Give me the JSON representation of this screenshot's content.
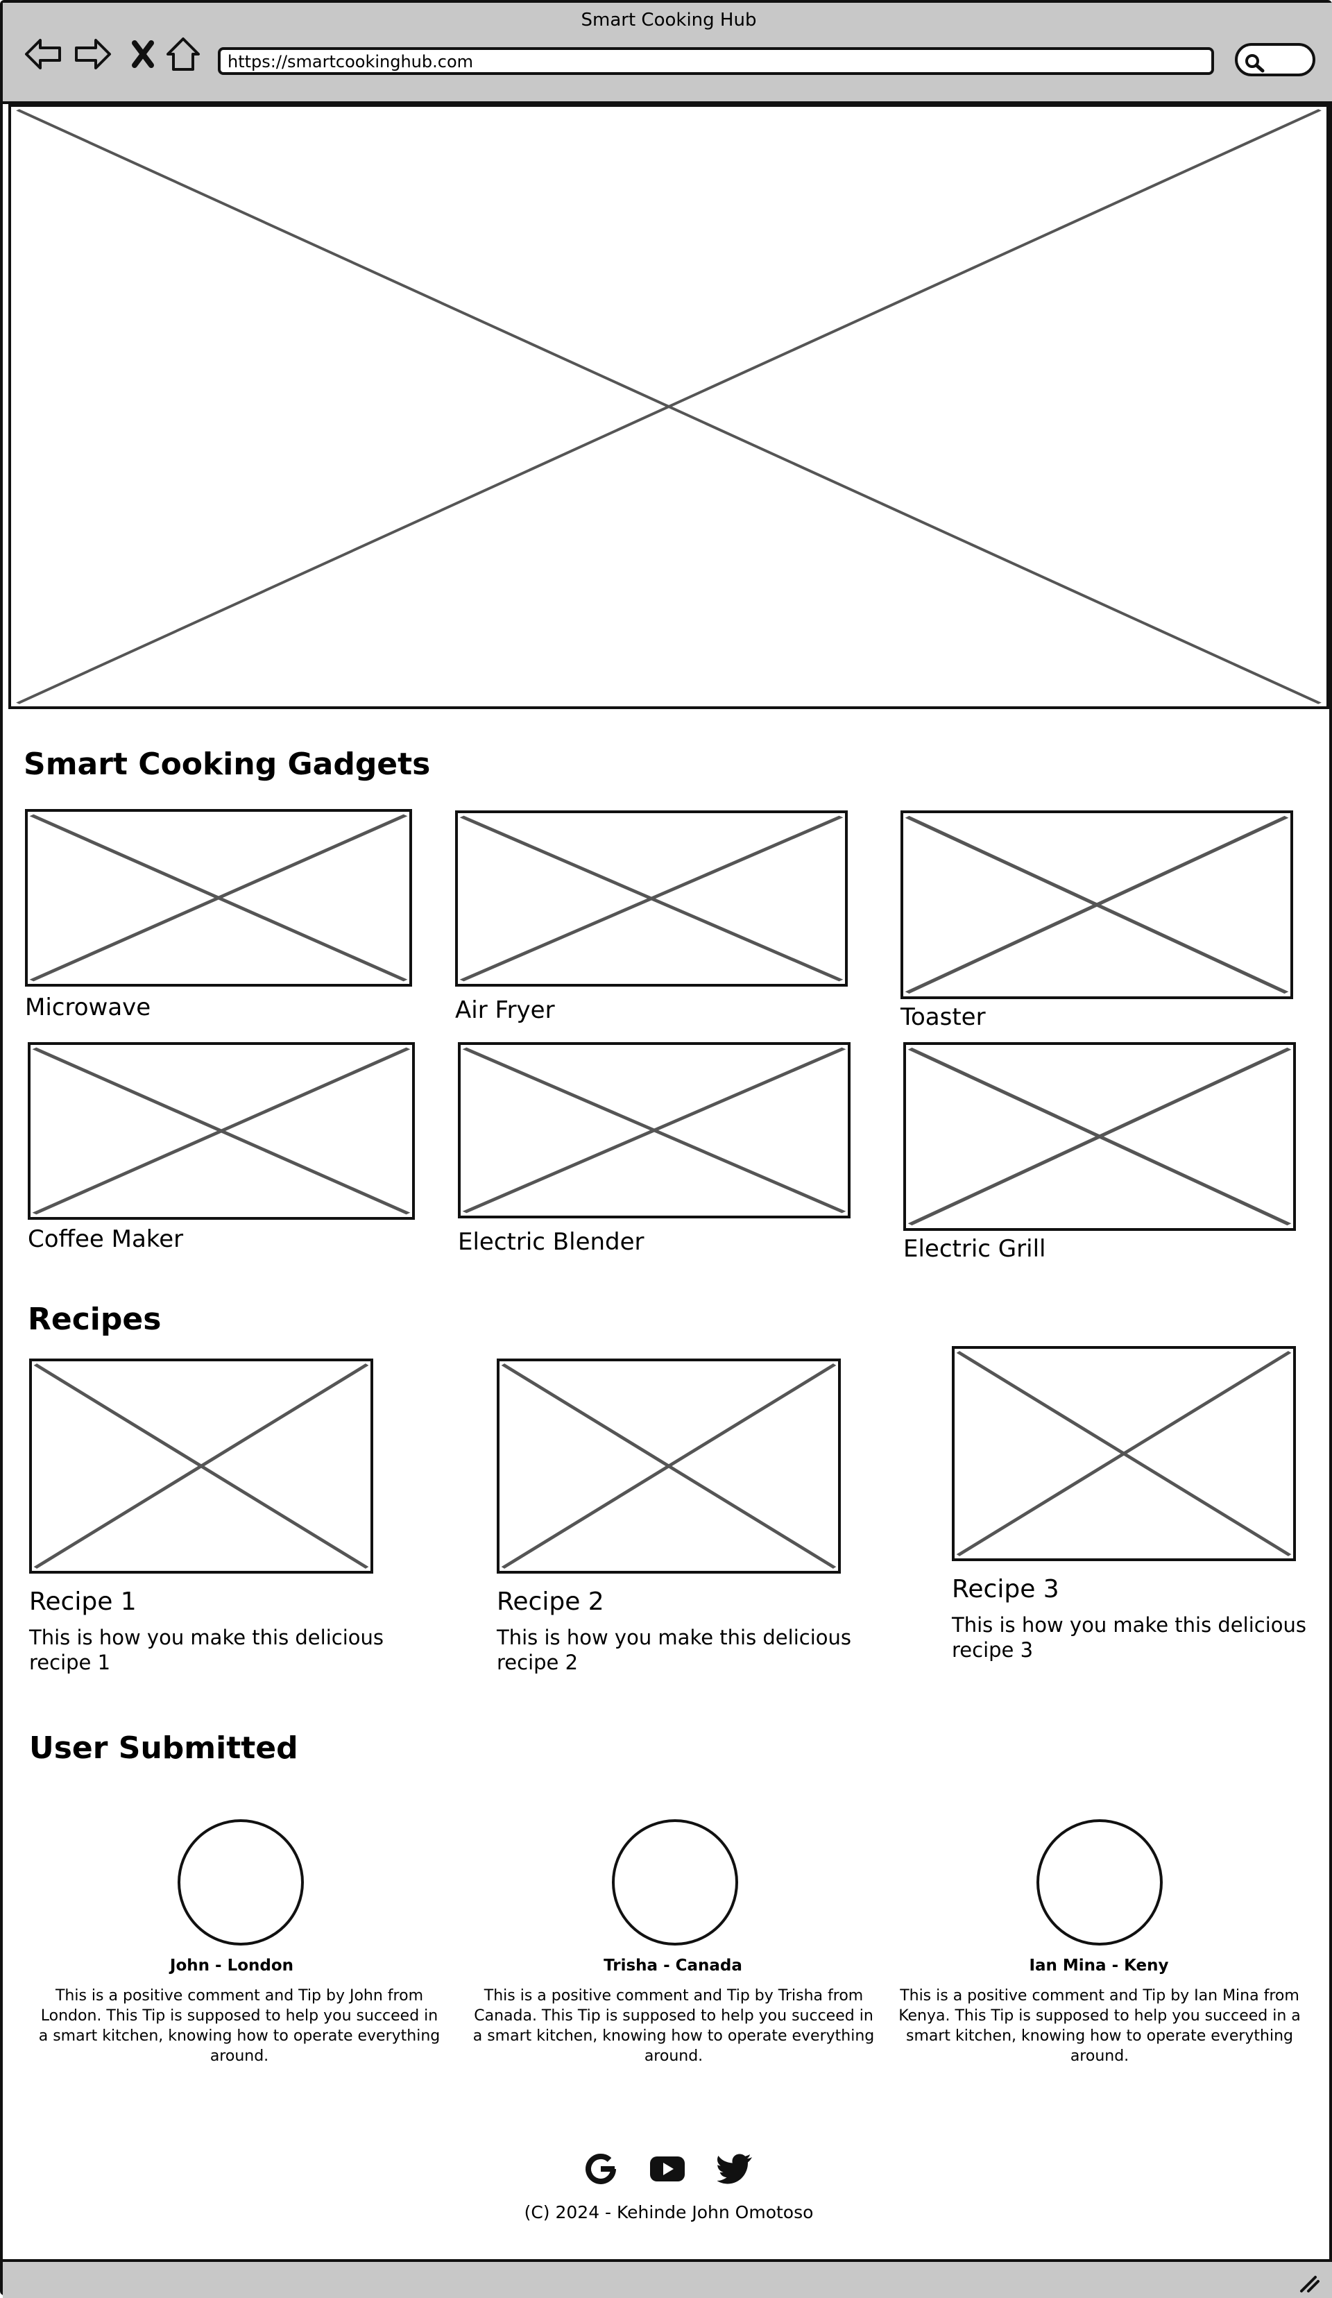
{
  "browser": {
    "title": "Smart Cooking Hub",
    "url": "https://smartcookinghub.com"
  },
  "hero": {
    "image": "hero-image-placeholder"
  },
  "gadgets": {
    "heading": "Smart Cooking Gadgets",
    "items": [
      {
        "label": "Microwave"
      },
      {
        "label": "Air Fryer"
      },
      {
        "label": "Toaster"
      },
      {
        "label": "Coffee Maker"
      },
      {
        "label": "Electric Blender"
      },
      {
        "label": "Electric Grill"
      }
    ]
  },
  "recipes": {
    "heading": "Recipes",
    "items": [
      {
        "title": "Recipe 1",
        "description": "This is how you make this delicious recipe 1"
      },
      {
        "title": "Recipe 2",
        "description": "This is how you make this delicious recipe 2"
      },
      {
        "title": "Recipe 3",
        "description": "This is how you make this delicious recipe 3"
      }
    ]
  },
  "user_submitted": {
    "heading": "User Submitted",
    "users": [
      {
        "name": "John - London",
        "comment": "This is a positive comment and Tip by John from London. This Tip is supposed to help you succeed in a smart kitchen, knowing how to operate everything around."
      },
      {
        "name": "Trisha - Canada",
        "comment": "This is a positive comment and Tip by Trisha from Canada. This Tip is supposed to help you succeed in a smart kitchen, knowing how to operate everything around."
      },
      {
        "name": "Ian Mina - Keny",
        "comment": "This is a positive comment and Tip by Ian Mina from Kenya. This Tip is supposed to help you succeed in a smart kitchen, knowing how to operate everything around."
      }
    ]
  },
  "footer": {
    "social_icons": [
      "google-icon",
      "youtube-icon",
      "twitter-icon"
    ],
    "copyright": "(C) 2024 - Kehinde John Omotoso"
  }
}
